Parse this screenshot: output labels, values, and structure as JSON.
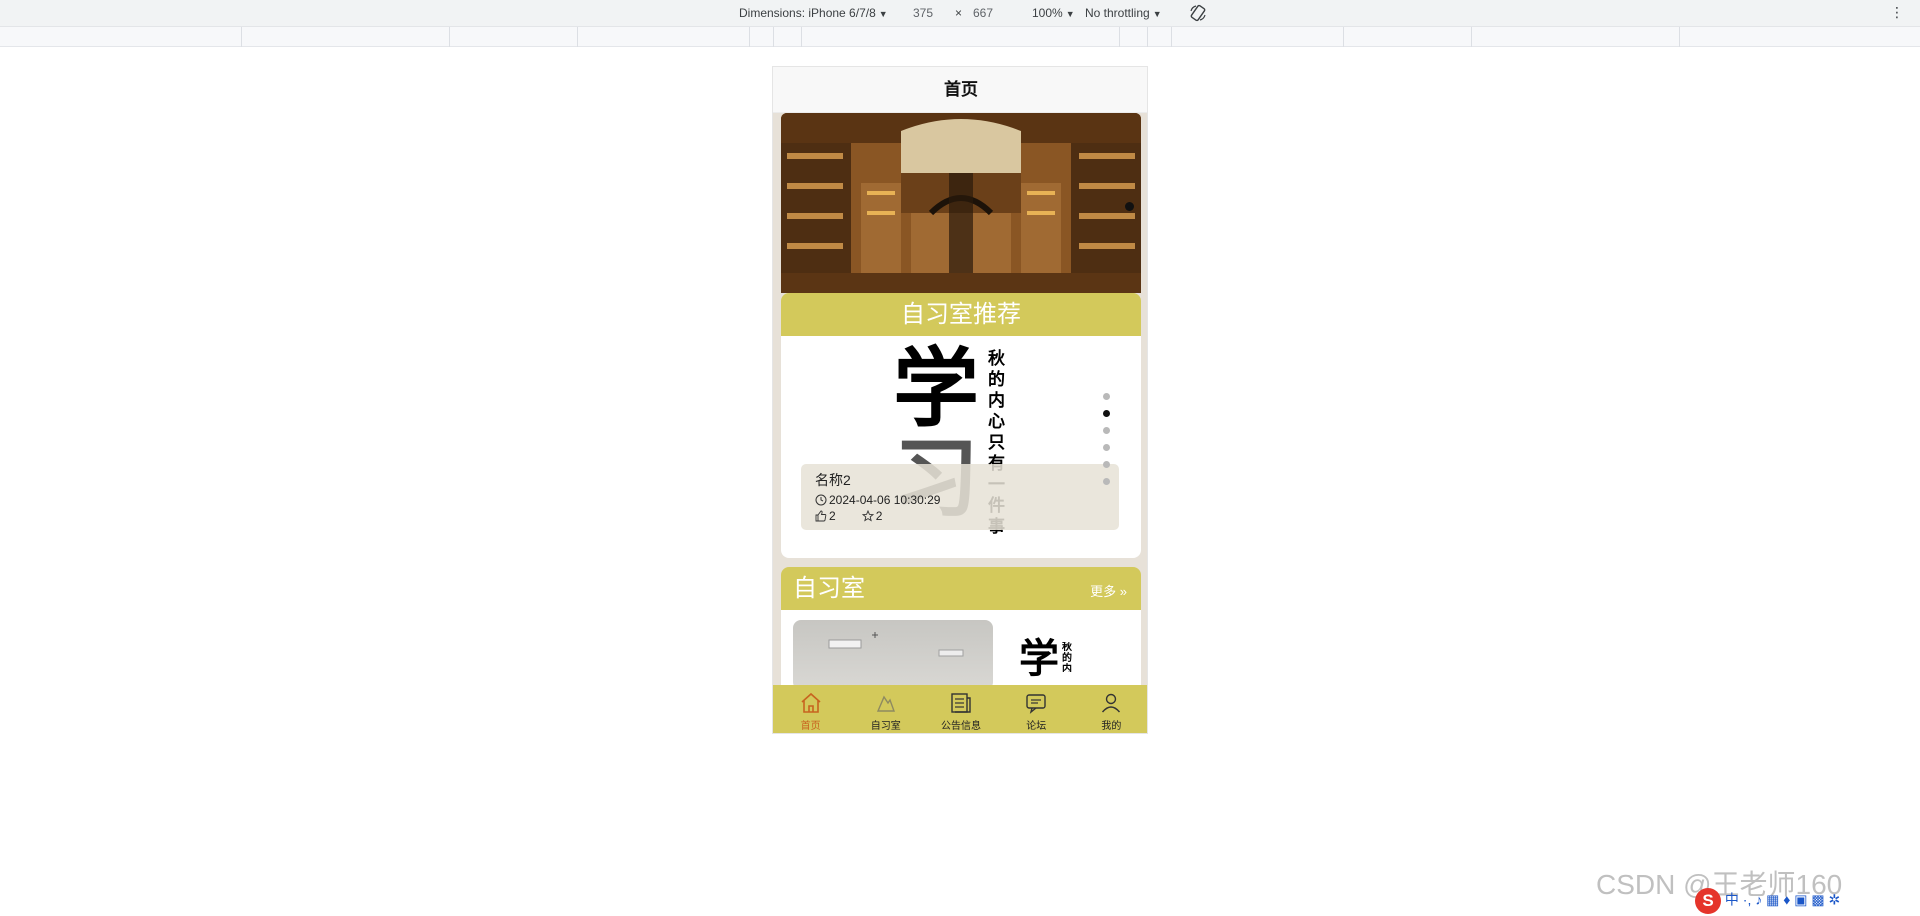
{
  "devtools": {
    "dimensions_label": "Dimensions: iPhone 6/7/8",
    "width": "375",
    "times": "×",
    "height": "667",
    "zoom": "100%",
    "throttling": "No throttling",
    "more_menu": "⋮"
  },
  "app": {
    "nav_title": "首页",
    "recommend": {
      "title": "自习室推荐",
      "slide_main_char1": "学",
      "slide_main_char2": "习",
      "slide_vertical_text": "秋的内心只有一件事",
      "item_name": "名称2",
      "item_time": "2024-04-06 10:30:29",
      "likes": "2",
      "favorites": "2",
      "dots_count": 6,
      "active_dot_index": 1
    },
    "rooms": {
      "title": "自习室",
      "more_label": "更多"
    },
    "tabbar": {
      "items": [
        {
          "label": "首页",
          "icon": "home-icon"
        },
        {
          "label": "自习室",
          "icon": "study-room-icon"
        },
        {
          "label": "公告信息",
          "icon": "notice-icon"
        },
        {
          "label": "论坛",
          "icon": "forum-icon"
        },
        {
          "label": "我的",
          "icon": "user-icon"
        }
      ],
      "active_index": 0
    }
  },
  "colors": {
    "accent": "#d3c95b",
    "active_tab": "#c8641f"
  },
  "overlay": {
    "watermark": "CSDN @王老师160",
    "ime_text": "中",
    "ime_logo": "S"
  }
}
